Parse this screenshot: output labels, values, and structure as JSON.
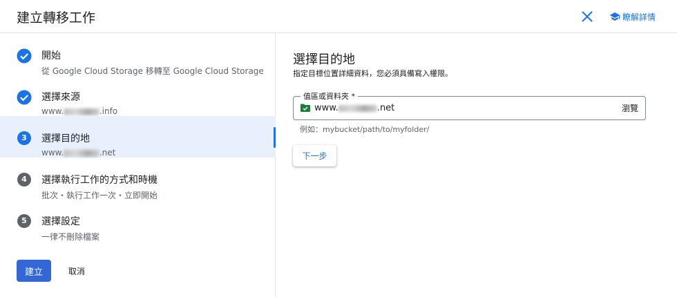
{
  "header": {
    "title": "建立轉移工作",
    "close_icon": "close-icon",
    "learn_more": "瞭解詳情",
    "learn_icon": "school-icon"
  },
  "steps": [
    {
      "state": "done",
      "label": "開始",
      "sub_prefix": "從 Google Cloud Storage 移轉至 Google Cloud Storage",
      "sub_blur": "",
      "sub_suffix": ""
    },
    {
      "state": "done",
      "label": "選擇來源",
      "sub_prefix": "www.",
      "sub_blur": "example",
      "sub_suffix": ".info"
    },
    {
      "state": "active",
      "number": "3",
      "label": "選擇目的地",
      "sub_prefix": "www.",
      "sub_blur": "example",
      "sub_suffix": ".net"
    },
    {
      "state": "pending",
      "number": "4",
      "label": "選擇執行工作的方式和時機",
      "sub_prefix": "批次・執行工作一次・立即開始",
      "sub_blur": "",
      "sub_suffix": ""
    },
    {
      "state": "pending",
      "number": "5",
      "label": "選擇設定",
      "sub_prefix": "一律不刪除檔案",
      "sub_blur": "",
      "sub_suffix": ""
    }
  ],
  "actions": {
    "create": "建立",
    "cancel": "取消"
  },
  "destination": {
    "title": "選擇目的地",
    "description": "指定目標位置詳細資料，您必須具備寫入權限。",
    "field_label": "值區或資料夾 *",
    "value_prefix": "www.",
    "value_blur": "example",
    "value_suffix": ".net",
    "browse": "瀏覽",
    "hint": "例如：mybucket/path/to/myfolder/",
    "next": "下一步",
    "folder_icon": "folder-check-icon"
  },
  "colors": {
    "accent": "#1a73e8",
    "primary_button": "#3367d6",
    "folder": "#188038",
    "step_pending": "#5f6368"
  }
}
